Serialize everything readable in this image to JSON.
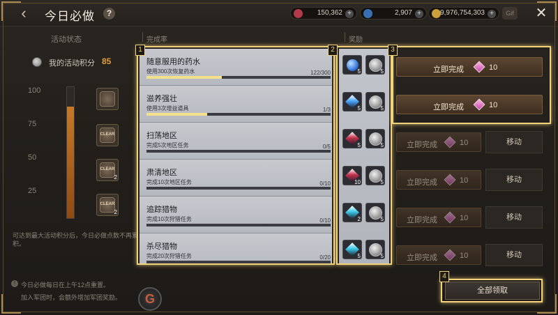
{
  "header": {
    "back_glyph": "‹",
    "title": "今日必做",
    "help_glyph": "?",
    "currencies": [
      {
        "name": "red-gem",
        "value": "150,362",
        "color": "#b23a4a"
      },
      {
        "name": "blue-gem",
        "value": "2,907",
        "color": "#3a6fb2"
      },
      {
        "name": "gold",
        "value": "9,976,754,303",
        "color": "#c9a03a"
      }
    ],
    "plus_glyph": "+",
    "gift_label": "Gif",
    "close_glyph": "✕"
  },
  "left": {
    "status_title": "活动状态",
    "points_label": "我的活动积分",
    "points_value": "85",
    "scale": [
      "100",
      "75",
      "50",
      "25"
    ],
    "progress": 0.85,
    "milestone_rewards": [
      {
        "label": "",
        "count": ""
      },
      {
        "label": "CLEAR",
        "count": ""
      },
      {
        "label": "CLEAR",
        "count": "2"
      },
      {
        "label": "CLEAR",
        "count": "2"
      }
    ],
    "footnote": "可达到最大活动积分后，今日必做点数不再累积。",
    "note1": "今日必做每日在上午12点重置。",
    "note2": "加入军团时，会额外增加军团奖励。"
  },
  "columns": {
    "completion": "完成率",
    "reward": "奖励"
  },
  "tasks": [
    {
      "name": "随意服用的药水",
      "desc": "使用300次恢复药水",
      "count": "122/300",
      "progress": 0.41
    },
    {
      "name": "滋养强壮",
      "desc": "使用3次增益道具",
      "count": "1/3",
      "progress": 0.33
    },
    {
      "name": "扫荡地区",
      "desc": "完成5次地区任务",
      "count": "0/5",
      "progress": 0
    },
    {
      "name": "肃清地区",
      "desc": "完成10次地区任务",
      "count": "0/10",
      "progress": 0
    },
    {
      "name": "追踪猎物",
      "desc": "完成10次狩猎任务",
      "count": "0/10",
      "progress": 0
    },
    {
      "name": "杀尽猎物",
      "desc": "完成20次狩猎任务",
      "count": "0/20",
      "progress": 0
    }
  ],
  "rewards": [
    {
      "item": "blue-orb",
      "item_color": "#3a7be0",
      "item_count": "5",
      "coin_count": "5"
    },
    {
      "item": "blue-crystal",
      "item_color": "#4aa6ff",
      "item_count": "5",
      "coin_count": "5"
    },
    {
      "item": "red-crystal",
      "item_color": "#c0304a",
      "item_count": "5",
      "coin_count": "5"
    },
    {
      "item": "red-crystal",
      "item_color": "#c0304a",
      "item_count": "10",
      "coin_count": "5"
    },
    {
      "item": "cyan-gem",
      "item_color": "#3ac8e8",
      "item_count": "2",
      "coin_count": "5"
    },
    {
      "item": "cyan-gem",
      "item_color": "#3ac8e8",
      "item_count": "5",
      "coin_count": "5"
    }
  ],
  "actions": {
    "complete_label": "立即完成",
    "complete_cost": "10",
    "move_label": "移动",
    "claim_all": "全部领取"
  },
  "highlights": [
    "1",
    "2",
    "3",
    "4"
  ]
}
